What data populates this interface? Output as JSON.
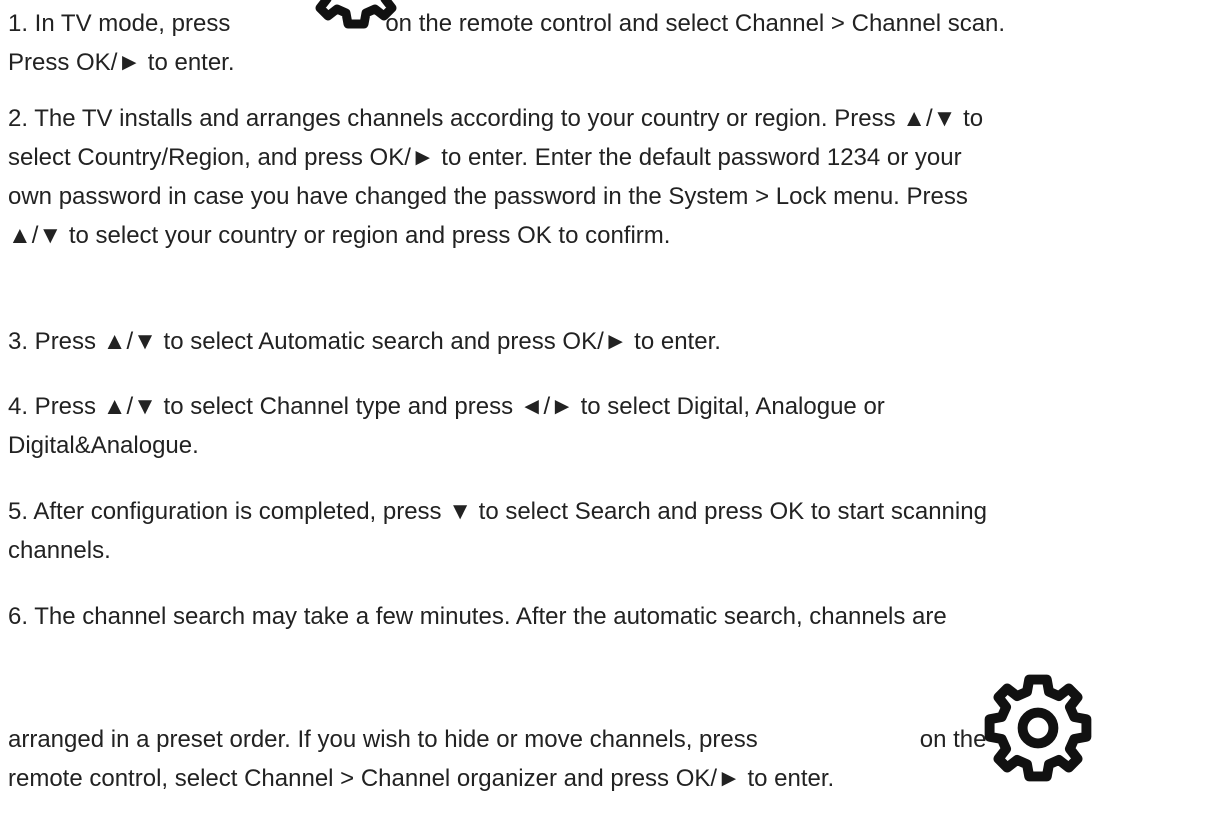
{
  "steps": [
    {
      "lines": [
        [
          "1. In TV mode, press",
          "on the remote control and select Channel > Channel scan."
        ],
        [
          "Press OK/► to enter."
        ]
      ]
    },
    {
      "lines": [
        [
          "2. The TV installs and arranges channels according to your country or region. Press ▲/▼ to"
        ],
        [
          "select Country/Region, and press OK/► to enter. Enter the default password 1234 or your"
        ],
        [
          "own password in case you have changed the password in the System > Lock menu. Press"
        ],
        [
          "▲/▼ to select your country or region and press OK to confirm."
        ]
      ]
    },
    {
      "lines": [
        [
          "3. Press ▲/▼ to select Automatic search and press OK/► to enter."
        ]
      ]
    },
    {
      "lines": [
        [
          "4. Press ▲/▼ to select Channel type and press ◄/► to select Digital, Analogue or"
        ],
        [
          "Digital&Analogue."
        ]
      ]
    },
    {
      "lines": [
        [
          "5. After configuration is completed, press ▼ to select Search and press OK to start scanning"
        ],
        [
          "channels."
        ]
      ]
    },
    {
      "lines": [
        [
          "6. The channel search may take a few minutes. After the automatic search, channels are"
        ],
        [
          "arranged in a preset order. If you wish to hide or move channels, press",
          "on the"
        ],
        [
          "remote control, select Channel > Channel organizer and press OK/► to enter."
        ]
      ]
    }
  ],
  "icons": {
    "settings": "gear-icon"
  },
  "colors": {
    "text": "#222222",
    "icon": "#111111",
    "background": "#ffffff"
  }
}
